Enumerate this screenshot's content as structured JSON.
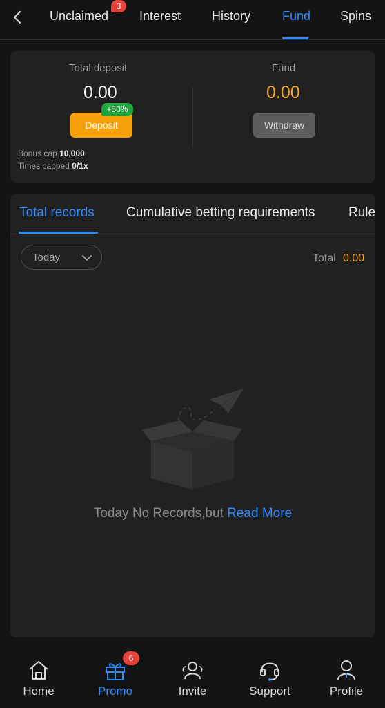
{
  "top_tabs": [
    {
      "label": "Unclaimed",
      "badge": "3"
    },
    {
      "label": "Interest"
    },
    {
      "label": "History"
    },
    {
      "label": "Fund",
      "active": true
    },
    {
      "label": "Spins"
    }
  ],
  "summary": {
    "total_deposit_label": "Total deposit",
    "total_deposit_value": "0.00",
    "deposit_button": "Deposit",
    "bonus_badge": "+50%",
    "fund_label": "Fund",
    "fund_value": "0.00",
    "withdraw_button": "Withdraw",
    "bonus_cap_label": "Bonus cap",
    "bonus_cap_value": "10,000",
    "times_capped_label": "Times capped",
    "times_capped_value": "0/1x"
  },
  "records": {
    "tabs": [
      {
        "label": "Total records",
        "active": true
      },
      {
        "label": "Cumulative betting requirements"
      },
      {
        "label": "Rule"
      }
    ],
    "filter_value": "Today",
    "total_label": "Total",
    "total_value": "0.00",
    "empty_text": "Today No Records,but",
    "read_more": "Read More"
  },
  "bottom_nav": [
    {
      "label": "Home",
      "icon": "home-icon"
    },
    {
      "label": "Promo",
      "icon": "gift-icon",
      "badge": "6",
      "active": true
    },
    {
      "label": "Invite",
      "icon": "people-icon"
    },
    {
      "label": "Support",
      "icon": "headset-icon"
    },
    {
      "label": "Profile",
      "icon": "user-icon"
    }
  ],
  "colors": {
    "accent": "#2f8cff",
    "gold": "#f5a623",
    "deposit": "#f5a20a",
    "badge_red": "#e5443a",
    "bonus_green": "#1fa33c",
    "card": "#212121",
    "background": "#141414"
  }
}
